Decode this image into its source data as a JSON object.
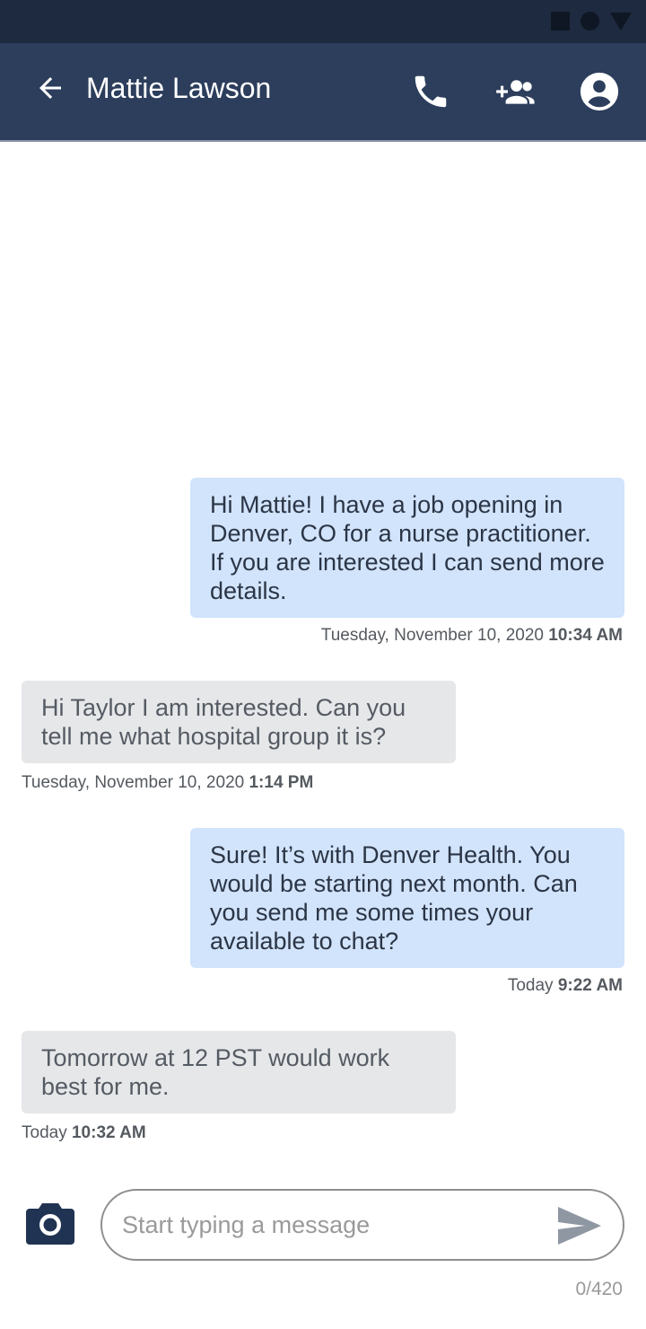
{
  "header": {
    "title": "Mattie Lawson",
    "back_icon": "arrow-back-icon",
    "actions": [
      "phone-icon",
      "add-people-icon",
      "account-circle-icon"
    ]
  },
  "messages": [
    {
      "direction": "outgoing",
      "text": "Hi Mattie! I have a job opening in Denver, CO for a nurse practitioner. If you are interested I can send more details.",
      "date": "Tuesday, November 10, 2020",
      "time": "10:34 AM"
    },
    {
      "direction": "incoming",
      "text": "Hi Taylor I am interested. Can you tell me what hospital group it is?",
      "date": "Tuesday, November 10, 2020",
      "time": "1:14 PM"
    },
    {
      "direction": "outgoing",
      "text": "Sure! It’s with Denver Health. You would be starting next month. Can you send me some times your available to chat?",
      "date": "Today",
      "time": "9:22 AM"
    },
    {
      "direction": "incoming",
      "text": "Tomorrow at 12 PST would work best for me.",
      "date": "Today",
      "time": "10:32 AM"
    }
  ],
  "composer": {
    "placeholder": "Start typing a message",
    "value": "",
    "counter": "0/420",
    "camera_icon": "camera-icon",
    "send_icon": "send-icon"
  },
  "colors": {
    "status_bar": "#1e2a3f",
    "app_bar": "#2c3e5c",
    "outgoing_bubble": "#d2e4fb",
    "incoming_bubble": "#e6e7e9"
  }
}
